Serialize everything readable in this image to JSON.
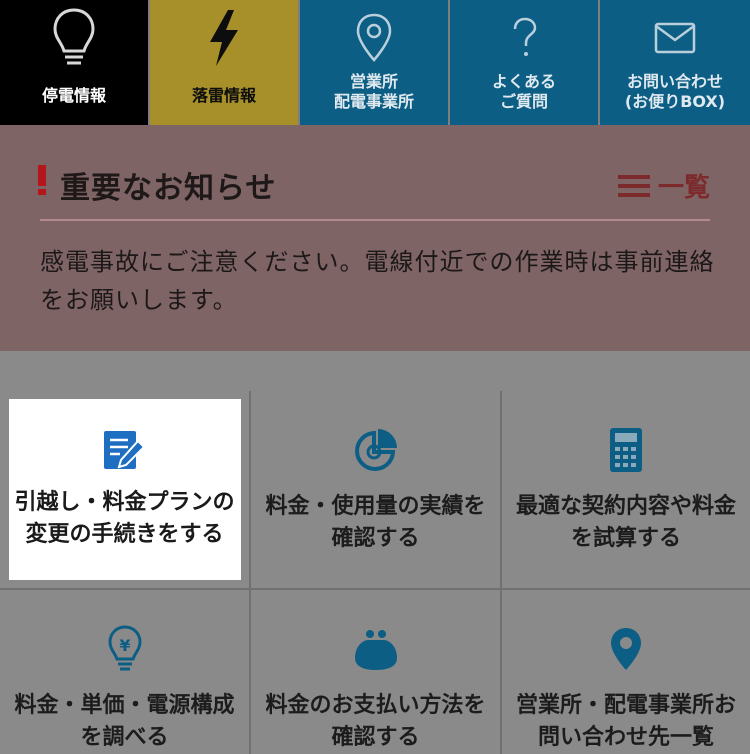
{
  "nav": [
    {
      "label": "停電情報",
      "icon": "lightbulb-icon"
    },
    {
      "label": "落雷情報",
      "icon": "lightning-icon"
    },
    {
      "label": "営業所\n配電事業所",
      "icon": "location-pin-icon"
    },
    {
      "label": "よくある\nご質問",
      "icon": "question-icon"
    },
    {
      "label": "お問い合わせ\n(お便りBOX)",
      "icon": "mail-icon"
    }
  ],
  "notice": {
    "title": "重要なお知らせ",
    "list_label": "一覧",
    "text": "感電事故にご注意ください。電線付近での作業時は事前連絡をお願いします。"
  },
  "tiles": [
    {
      "label": "引越し・料金プランの変更の手続きをする",
      "icon": "document-edit-icon"
    },
    {
      "label": "料金・使用量の実績を確認する",
      "icon": "pie-chart-icon"
    },
    {
      "label": "最適な契約内容や料金を試算する",
      "icon": "calculator-icon"
    },
    {
      "label": "料金・単価・電源構成を調べる",
      "icon": "yen-bulb-icon"
    },
    {
      "label": "料金のお支払い方法を確認する",
      "icon": "purse-icon"
    },
    {
      "label": "営業所・配電事業所お問い合わせ先一覧",
      "icon": "location-pin-icon"
    }
  ],
  "colors": {
    "nav_outage": "#000000",
    "nav_lightning": "#a7902a",
    "nav_blue": "#0c5e85",
    "notice_bg": "#7f6466",
    "accent_red": "#b4161b",
    "icon_blue": "#0c5e85"
  }
}
